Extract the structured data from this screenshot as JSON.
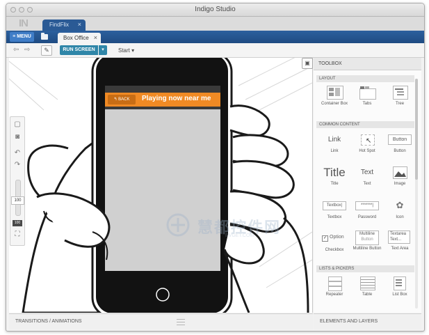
{
  "window": {
    "title": "Indigo Studio"
  },
  "app": {
    "logo": "IN"
  },
  "project_tab": {
    "label": "FindFlix",
    "close": "×"
  },
  "nav": {
    "menu_label": "≡ MENU",
    "screen_tab": {
      "label": "Box Office",
      "close": "×"
    }
  },
  "toolbar": {
    "back": "⇦",
    "forward": "⇨",
    "run_label": "RUN SCREEN",
    "run_caret": "▾",
    "start_label": "Start ▾"
  },
  "prototype": {
    "back_label": "BACK",
    "header_title": "Playing now near me",
    "header_color": "#f08a24"
  },
  "left_tools": {
    "zoom_value": "100",
    "fit_label": "100"
  },
  "bottom": {
    "transitions_label": "TRANSITIONS / ANIMATIONS",
    "elements_label": "ELEMENTS AND LAYERS"
  },
  "toolbox": {
    "title": "TOOLBOX",
    "sections": [
      {
        "title": "LAYOUT",
        "items": [
          {
            "label": "Container Box",
            "icon": "container-box-icon"
          },
          {
            "label": "Tabs",
            "icon": "tabs-icon"
          },
          {
            "label": "Tree",
            "icon": "tree-icon"
          }
        ]
      },
      {
        "title": "COMMON CONTENT",
        "items": [
          {
            "label": "Link",
            "icon": "link-icon",
            "glyph": "Link"
          },
          {
            "label": "Hot Spot",
            "icon": "hot-spot-icon"
          },
          {
            "label": "Button",
            "icon": "button-icon",
            "glyph": "Button"
          },
          {
            "label": "Title",
            "icon": "title-icon",
            "glyph": "Title"
          },
          {
            "label": "Text",
            "icon": "text-icon",
            "glyph": "Text"
          },
          {
            "label": "Image",
            "icon": "image-icon"
          },
          {
            "label": "Textbox",
            "icon": "textbox-icon",
            "glyph": "Textbox|"
          },
          {
            "label": "Password",
            "icon": "password-icon",
            "glyph": "*******|"
          },
          {
            "label": "Icon",
            "icon": "icon-icon"
          },
          {
            "label": "Checkbox",
            "icon": "checkbox-icon",
            "glyph": "Option"
          },
          {
            "label": "Multiline Button",
            "icon": "multiline-button-icon",
            "glyph": "Multiline",
            "glyph2": "Button"
          },
          {
            "label": "Text Area",
            "icon": "text-area-icon",
            "glyph": "Textarea",
            "glyph2": "Text..."
          }
        ]
      },
      {
        "title": "LISTS & PICKERS",
        "items": [
          {
            "label": "Repeater",
            "icon": "repeater-icon"
          },
          {
            "label": "Table",
            "icon": "table-icon"
          },
          {
            "label": "List Box",
            "icon": "list-box-icon"
          }
        ]
      }
    ]
  },
  "watermark": {
    "text": "慧都控件网",
    "sub": "EVGET.COM"
  },
  "colors": {
    "nav_blue": "#1f4b82",
    "accent_teal": "#2f86a8",
    "orange": "#f08a24"
  }
}
